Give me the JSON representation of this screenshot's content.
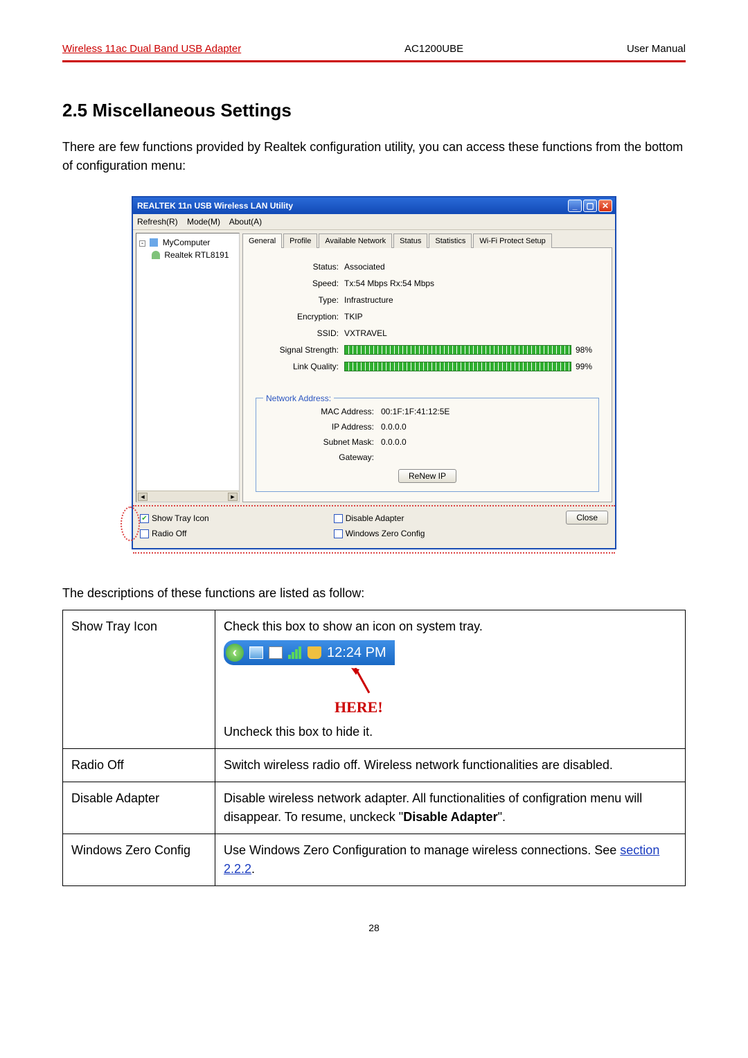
{
  "header": {
    "left": "Wireless 11ac Dual Band USB Adapter",
    "mid": "AC1200UBE",
    "right": "User Manual"
  },
  "section_title": "2.5 Miscellaneous Settings",
  "intro": "There are few functions provided by Realtek configuration utility, you can access these functions from the bottom of configuration menu:",
  "dialog": {
    "title": "REALTEK 11n USB Wireless LAN Utility",
    "menu": {
      "refresh": "Refresh(R)",
      "mode": "Mode(M)",
      "about": "About(A)"
    },
    "tree": {
      "root": "MyComputer",
      "adapter": "Realtek RTL8191"
    },
    "tabs": [
      "General",
      "Profile",
      "Available Network",
      "Status",
      "Statistics",
      "Wi-Fi Protect Setup"
    ],
    "status": {
      "status_k": "Status:",
      "status_v": "Associated",
      "speed_k": "Speed:",
      "speed_v": "Tx:54 Mbps Rx:54 Mbps",
      "type_k": "Type:",
      "type_v": "Infrastructure",
      "enc_k": "Encryption:",
      "enc_v": "TKIP",
      "ssid_k": "SSID:",
      "ssid_v": "VXTRAVEL",
      "sig_k": "Signal Strength:",
      "sig_pct": "98%",
      "lq_k": "Link Quality:",
      "lq_pct": "99%"
    },
    "netaddr": {
      "legend": "Network Address:",
      "mac_k": "MAC Address:",
      "mac_v": "00:1F:1F:41:12:5E",
      "ip_k": "IP Address:",
      "ip_v": "0.0.0.0",
      "mask_k": "Subnet Mask:",
      "mask_v": "0.0.0.0",
      "gw_k": "Gateway:",
      "gw_v": "",
      "renew": "ReNew IP"
    },
    "footer": {
      "show_tray": "Show Tray Icon",
      "radio_off": "Radio Off",
      "disable": "Disable Adapter",
      "wzc": "Windows Zero Config",
      "close": "Close"
    }
  },
  "desc_intro": "The descriptions of these functions are listed as follow:",
  "table": {
    "r1k": "Show Tray Icon",
    "r1a": "Check this box to show an icon on system tray.",
    "tray_time": "12:24 PM",
    "here": "HERE!",
    "r1b": "Uncheck this box to hide it.",
    "r2k": "Radio Off",
    "r2v": "Switch wireless radio off. Wireless network functionalities are disabled.",
    "r3k": "Disable Adapter",
    "r3v_a": "Disable wireless network adapter. All functionalities of configration menu will disappear. To resume, unckeck \"",
    "r3v_b": "Disable Adapter",
    "r3v_c": "\".",
    "r4k": "Windows Zero Config",
    "r4v_a": "Use Windows Zero Configuration to manage wireless connections. See ",
    "r4v_link": "section 2.2.2",
    "r4v_b": "."
  },
  "page_number": "28"
}
